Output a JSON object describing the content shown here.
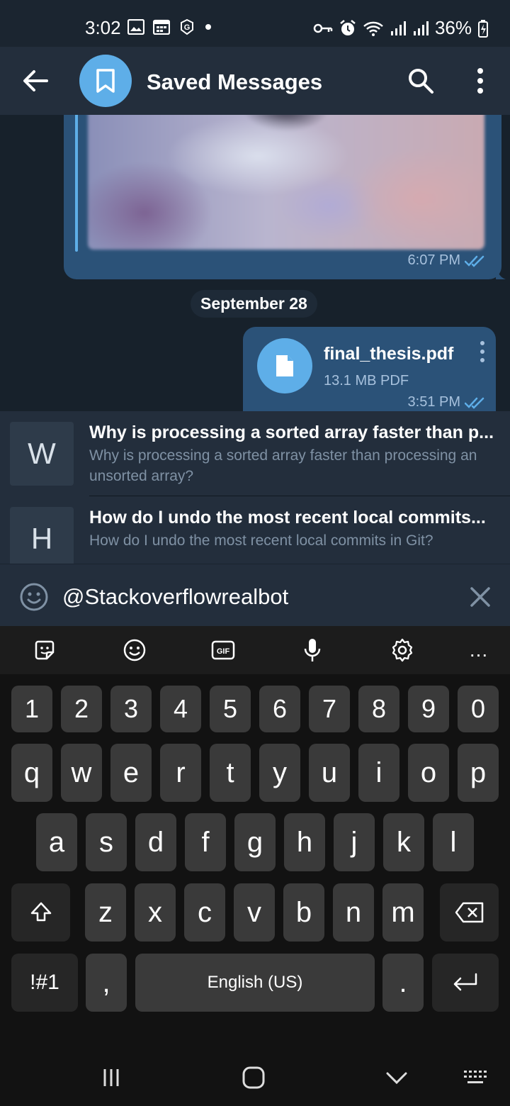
{
  "status_bar": {
    "time": "3:02",
    "battery": "36%",
    "icons_left": [
      "gallery-icon",
      "calendar-icon",
      "g-circle-icon",
      "dot-icon"
    ],
    "icons_right": [
      "vpn-key-icon",
      "alarm-icon",
      "wifi-icon",
      "signal-icon",
      "signal-icon",
      "battery-charging-icon"
    ]
  },
  "header": {
    "title": "Saved Messages",
    "icons": [
      "back-arrow-icon",
      "bookmark-icon",
      "search-icon",
      "more-vert-icon"
    ]
  },
  "messages": {
    "media_time": "6:07 PM",
    "date_separator": "September 28",
    "file": {
      "name": "final_thesis.pdf",
      "size": "13.1 MB PDF",
      "time": "3:51 PM"
    }
  },
  "inline_results": [
    {
      "letter": "W",
      "title": "Why is processing a sorted array faster than p...",
      "description": "Why is processing a sorted array faster than processing an unsorted array?"
    },
    {
      "letter": "H",
      "title": "How do I undo the most recent local commits...",
      "description": "How do I undo the most recent local commits in Git?"
    }
  ],
  "input": {
    "value": "@Stackoverflowrealbot"
  },
  "keyboard": {
    "toolbar": [
      "sticker-icon",
      "emoji-icon",
      "gif-icon",
      "mic-icon",
      "settings-icon",
      "more-horiz-icon"
    ],
    "gif_label": "GIF",
    "more_label": "...",
    "row_numbers": [
      "1",
      "2",
      "3",
      "4",
      "5",
      "6",
      "7",
      "8",
      "9",
      "0"
    ],
    "row_top": [
      "q",
      "w",
      "e",
      "r",
      "t",
      "y",
      "u",
      "i",
      "o",
      "p"
    ],
    "row_middle": [
      "a",
      "s",
      "d",
      "f",
      "g",
      "h",
      "j",
      "k",
      "l"
    ],
    "row_bottom": [
      "z",
      "x",
      "c",
      "v",
      "b",
      "n",
      "m"
    ],
    "symbols_key": "!#1",
    "comma_key": ",",
    "space_label": "English (US)",
    "period_key": "."
  },
  "colors": {
    "background": "#17212b",
    "header": "#232e3c",
    "bubble_out": "#2b5278",
    "accent": "#5eaee8",
    "keyboard_bg": "#121212",
    "key_bg": "#3a3a3a"
  }
}
